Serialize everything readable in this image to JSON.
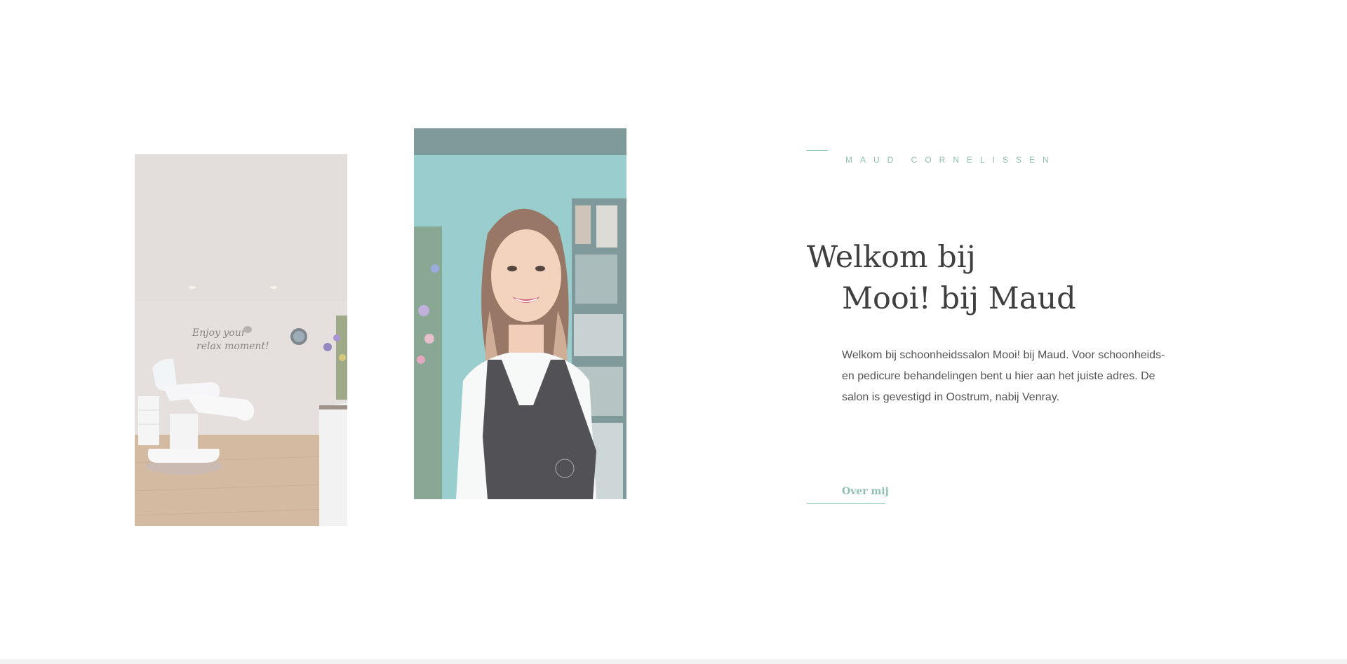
{
  "about": {
    "eyebrow": "MAUD CORNELISSEN",
    "heading_line1": "Welkom bij",
    "heading_line2": "Mooi! bij Maud",
    "intro": "Welkom bij schoonheidssalon Mooi! bij Maud. Voor schoonheids- en pedicure behandelingen bent u hier aan het juiste adres. De salon is gevestigd in Oostrum, nabij Venray.",
    "cta_label": "Over mij"
  },
  "images": {
    "salon": {
      "wall_text_line1": "Enjoy your",
      "wall_text_line2": "relax moment!"
    }
  },
  "colors": {
    "accent": "#8fbfb1",
    "heading": "#3f3f3f",
    "body_text": "#555555",
    "background": "#ffffff"
  }
}
